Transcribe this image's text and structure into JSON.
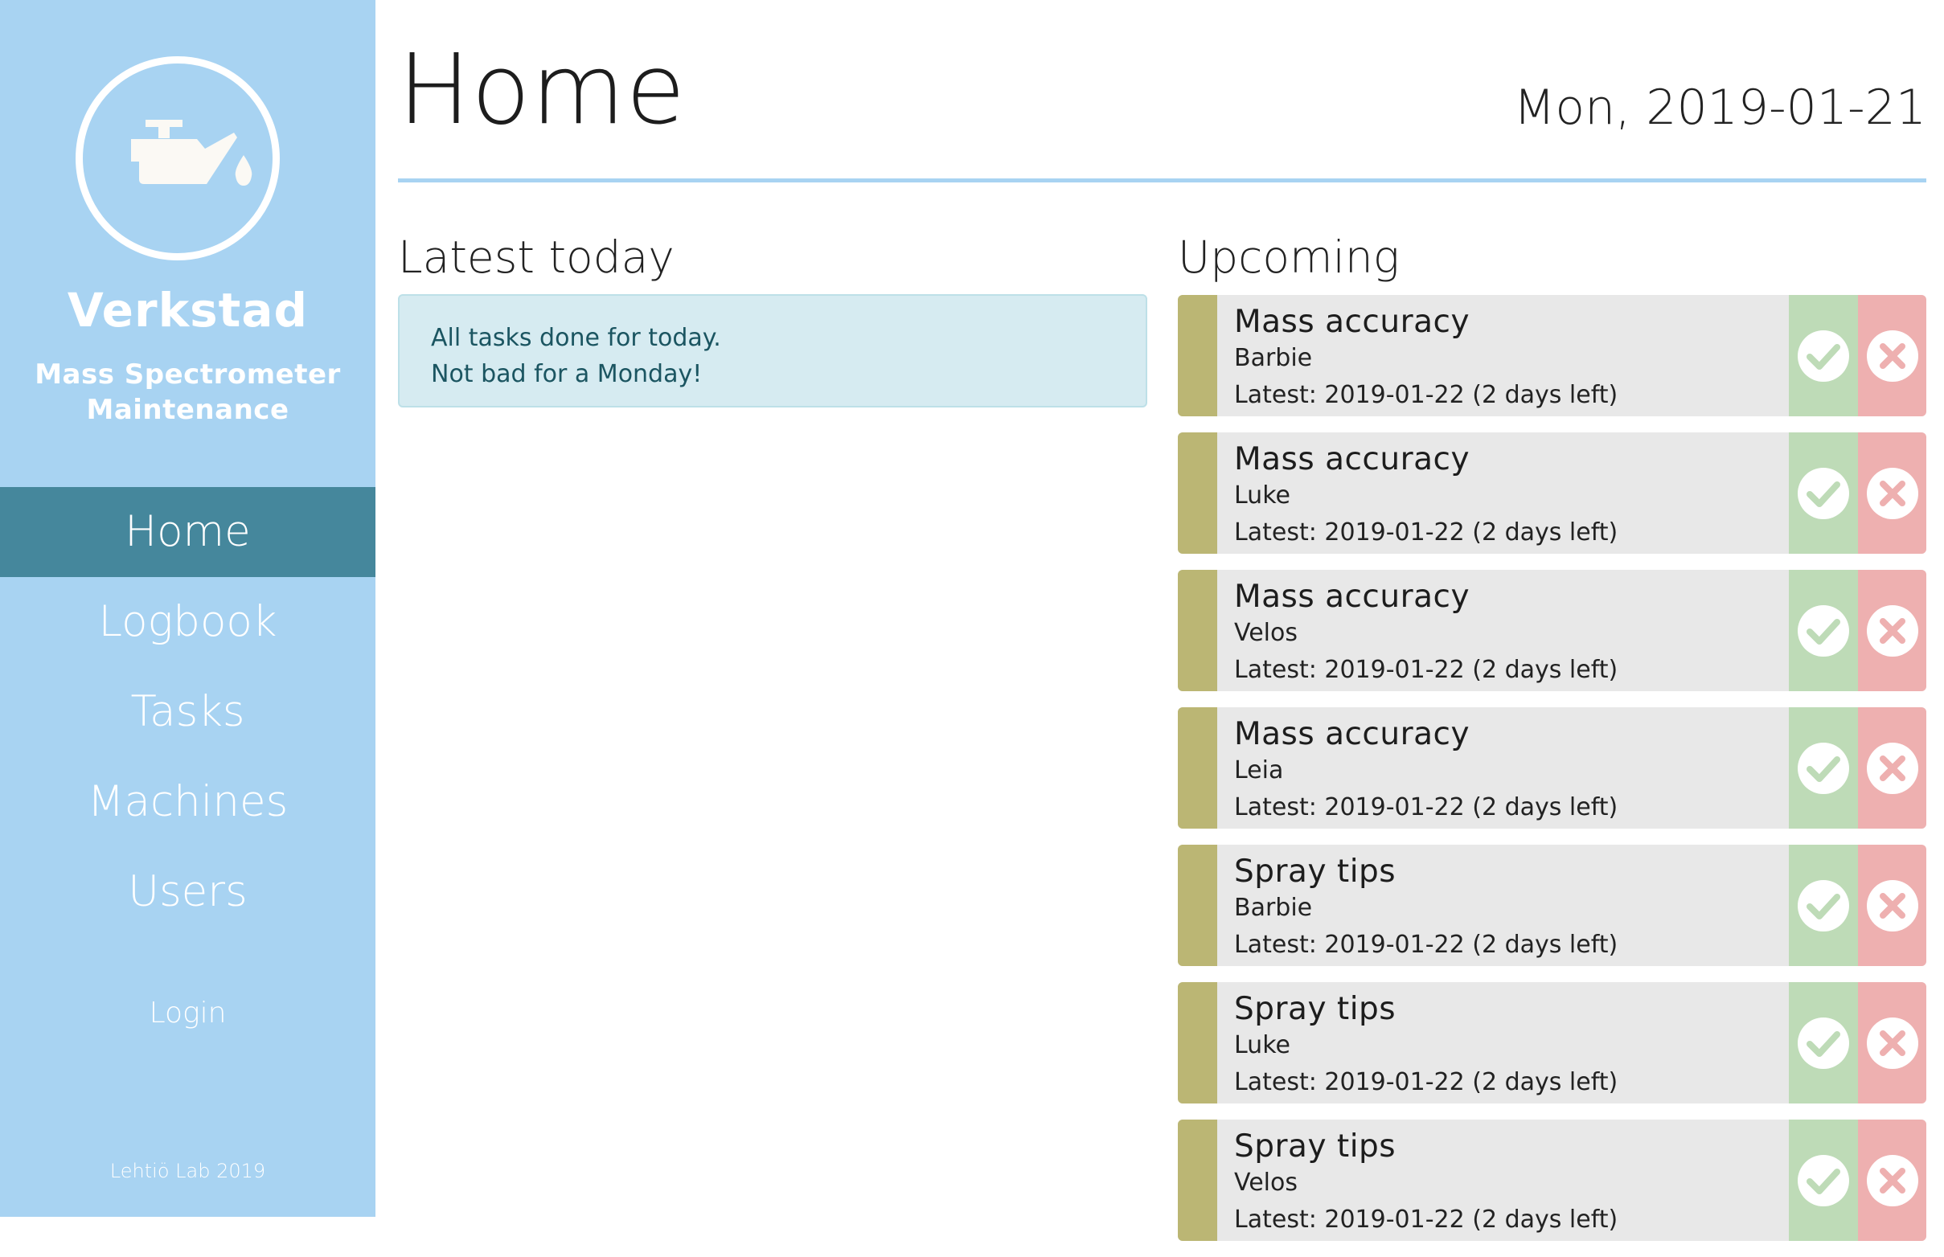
{
  "sidebar": {
    "brand": "Verkstad",
    "subtitle_line1": "Mass Spectrometer",
    "subtitle_line2": "Maintenance",
    "logo_icon": "oil-can-icon",
    "nav": [
      {
        "label": "Home",
        "active": true
      },
      {
        "label": "Logbook",
        "active": false
      },
      {
        "label": "Tasks",
        "active": false
      },
      {
        "label": "Machines",
        "active": false
      },
      {
        "label": "Users",
        "active": false
      }
    ],
    "login_label": "Login",
    "footer": "Lehtiö Lab 2019"
  },
  "header": {
    "title": "Home",
    "date": "Mon, 2019-01-21"
  },
  "latest": {
    "title": "Latest today",
    "message_line1": "All tasks done for today.",
    "message_line2": "Not bad for a Monday!"
  },
  "upcoming": {
    "title": "Upcoming",
    "tasks": [
      {
        "name": "Mass accuracy",
        "machine": "Barbie",
        "latest": "Latest: 2019-01-22 (2 days left)"
      },
      {
        "name": "Mass accuracy",
        "machine": "Luke",
        "latest": "Latest: 2019-01-22 (2 days left)"
      },
      {
        "name": "Mass accuracy",
        "machine": "Velos",
        "latest": "Latest: 2019-01-22 (2 days left)"
      },
      {
        "name": "Mass accuracy",
        "machine": "Leia",
        "latest": "Latest: 2019-01-22 (2 days left)"
      },
      {
        "name": "Spray tips",
        "machine": "Barbie",
        "latest": "Latest: 2019-01-22 (2 days left)"
      },
      {
        "name": "Spray tips",
        "machine": "Luke",
        "latest": "Latest: 2019-01-22 (2 days left)"
      },
      {
        "name": "Spray tips",
        "machine": "Velos",
        "latest": "Latest: 2019-01-22 (2 days left)"
      }
    ]
  },
  "colors": {
    "sidebar_bg": "#a8d3f2",
    "nav_active_bg": "#45879c",
    "task_stripe": "#bbb674",
    "done_bg": "#bedbb7",
    "skip_bg": "#eeb0b0",
    "alert_bg": "#d6ebf1"
  }
}
